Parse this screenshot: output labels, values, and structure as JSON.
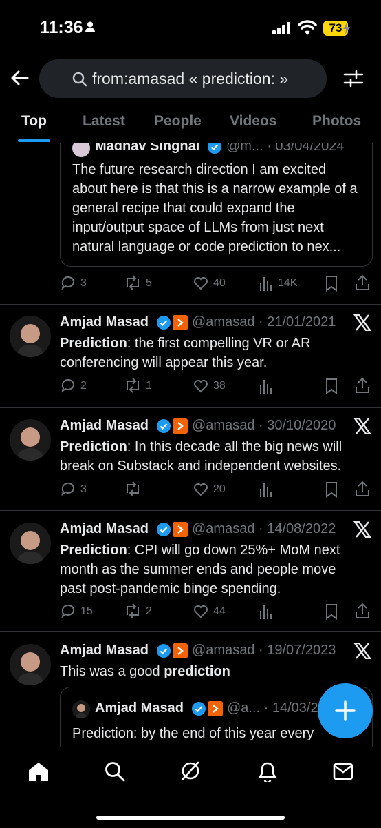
{
  "status_bar": {
    "time": "11:36",
    "battery": "73"
  },
  "search": {
    "query": "from:amasad « prediction: »"
  },
  "tabs": [
    "Top",
    "Latest",
    "People",
    "Videos",
    "Photos"
  ],
  "feed": {
    "partial_quote": {
      "name": "Madhav Singhal",
      "handle_date": "@m... · 03/04/2024",
      "text": "The future research direction I am excited about here is that this is a narrow example of a general recipe that could expand the input/output space of LLMs from just next natural language or code prediction to nex...",
      "replies": "3",
      "reposts": "5",
      "likes": "40",
      "views": "14K"
    },
    "posts": [
      {
        "name": "Amjad Masad",
        "handle_date": "@amasad · 21/01/2021",
        "bold": "Prediction",
        "text": ": the first compelling VR or AR conferencing will appear this year.",
        "replies": "2",
        "reposts": "1",
        "likes": "38"
      },
      {
        "name": "Amjad Masad",
        "handle_date": "@amasad · 30/10/2020",
        "bold": "Prediction",
        "text": ": In this decade all the big news will break on Substack and independent websites.",
        "replies": "3",
        "reposts": "",
        "likes": "20"
      },
      {
        "name": "Amjad Masad",
        "handle_date": "@amasad · 14/08/2022",
        "bold": "Prediction",
        "text": ": CPI will go down 25%+ MoM next month as the summer ends and people move past post-pandemic binge spending.",
        "replies": "15",
        "reposts": "2",
        "likes": "44"
      },
      {
        "name": "Amjad Masad",
        "handle_date": "@amasad · 19/07/2023",
        "text_before": "This was a good ",
        "bold": "prediction",
        "quote": {
          "name": "Amjad Masad",
          "handle_date": "@a... · 14/03/2",
          "text": "Prediction: by the end of this year every"
        }
      }
    ]
  },
  "icons": {
    "platform": "x-logo-icon",
    "fab": "plus-icon"
  },
  "colors": {
    "accent": "#1d9bf0",
    "verified": "#1d9bf0",
    "affiliate": "#f26207",
    "muted": "#71767b"
  }
}
